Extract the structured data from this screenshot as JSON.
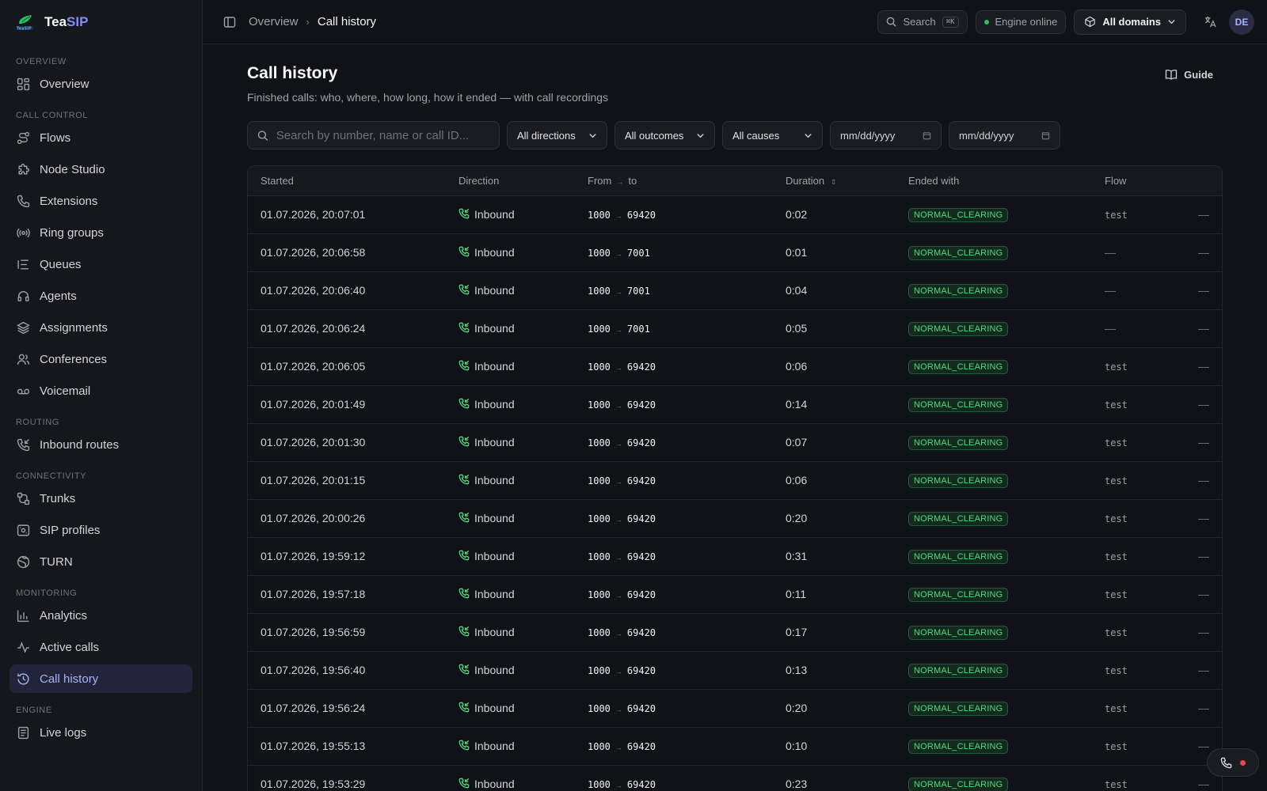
{
  "brand": {
    "name_a": "Tea",
    "name_b": "SIP"
  },
  "sidebar": {
    "sections": [
      {
        "heading": "OVERVIEW",
        "items": [
          {
            "label": "Overview",
            "icon": "grid-icon"
          }
        ]
      },
      {
        "heading": "CALL CONTROL",
        "items": [
          {
            "label": "Flows",
            "icon": "flows-icon"
          },
          {
            "label": "Node Studio",
            "icon": "puzzle-icon"
          },
          {
            "label": "Extensions",
            "icon": "phone-icon"
          },
          {
            "label": "Ring groups",
            "icon": "radio-icon"
          },
          {
            "label": "Queues",
            "icon": "list-icon"
          },
          {
            "label": "Agents",
            "icon": "headset-icon"
          },
          {
            "label": "Assignments",
            "icon": "layers-icon"
          },
          {
            "label": "Conferences",
            "icon": "users-icon"
          },
          {
            "label": "Voicemail",
            "icon": "voicemail-icon"
          }
        ]
      },
      {
        "heading": "ROUTING",
        "items": [
          {
            "label": "Inbound routes",
            "icon": "phone-incoming-icon"
          }
        ]
      },
      {
        "heading": "CONNECTIVITY",
        "items": [
          {
            "label": "Trunks",
            "icon": "trunk-icon"
          },
          {
            "label": "SIP profiles",
            "icon": "sip-icon"
          },
          {
            "label": "TURN",
            "icon": "globe-icon"
          }
        ]
      },
      {
        "heading": "MONITORING",
        "items": [
          {
            "label": "Analytics",
            "icon": "bar-chart-icon"
          },
          {
            "label": "Active calls",
            "icon": "activity-icon"
          },
          {
            "label": "Call history",
            "icon": "history-icon",
            "active": true
          }
        ]
      },
      {
        "heading": "ENGINE",
        "items": [
          {
            "label": "Live logs",
            "icon": "logs-icon"
          }
        ]
      }
    ]
  },
  "topbar": {
    "breadcrumb": [
      "Overview",
      "Call history"
    ],
    "search_label": "Search",
    "search_kbd": "⌘K",
    "engine_status": "Engine online",
    "domains_label": "All domains",
    "avatar": "DE"
  },
  "page": {
    "title": "Call history",
    "subtitle": "Finished calls: who, where, how long, how it ended — with call recordings",
    "guide_label": "Guide"
  },
  "filters": {
    "search_placeholder": "Search by number, name or call ID...",
    "directions": "All directions",
    "outcomes": "All outcomes",
    "causes": "All causes",
    "date_from": "mm/dd/yyyy",
    "date_to": "mm/dd/yyyy"
  },
  "table": {
    "headers": [
      "Started",
      "Direction",
      "From",
      "to",
      "Duration",
      "Ended with",
      "Flow"
    ],
    "rows": [
      {
        "started": "01.07.2026, 20:07:01",
        "direction": "Inbound",
        "from": "1000",
        "to": "69420",
        "duration": "0:02",
        "ended": "NORMAL_CLEARING",
        "flow": "test",
        "rec": "—"
      },
      {
        "started": "01.07.2026, 20:06:58",
        "direction": "Inbound",
        "from": "1000",
        "to": "7001",
        "duration": "0:01",
        "ended": "NORMAL_CLEARING",
        "flow": "—",
        "rec": "—"
      },
      {
        "started": "01.07.2026, 20:06:40",
        "direction": "Inbound",
        "from": "1000",
        "to": "7001",
        "duration": "0:04",
        "ended": "NORMAL_CLEARING",
        "flow": "—",
        "rec": "—"
      },
      {
        "started": "01.07.2026, 20:06:24",
        "direction": "Inbound",
        "from": "1000",
        "to": "7001",
        "duration": "0:05",
        "ended": "NORMAL_CLEARING",
        "flow": "—",
        "rec": "—"
      },
      {
        "started": "01.07.2026, 20:06:05",
        "direction": "Inbound",
        "from": "1000",
        "to": "69420",
        "duration": "0:06",
        "ended": "NORMAL_CLEARING",
        "flow": "test",
        "rec": "—"
      },
      {
        "started": "01.07.2026, 20:01:49",
        "direction": "Inbound",
        "from": "1000",
        "to": "69420",
        "duration": "0:14",
        "ended": "NORMAL_CLEARING",
        "flow": "test",
        "rec": "—"
      },
      {
        "started": "01.07.2026, 20:01:30",
        "direction": "Inbound",
        "from": "1000",
        "to": "69420",
        "duration": "0:07",
        "ended": "NORMAL_CLEARING",
        "flow": "test",
        "rec": "—"
      },
      {
        "started": "01.07.2026, 20:01:15",
        "direction": "Inbound",
        "from": "1000",
        "to": "69420",
        "duration": "0:06",
        "ended": "NORMAL_CLEARING",
        "flow": "test",
        "rec": "—"
      },
      {
        "started": "01.07.2026, 20:00:26",
        "direction": "Inbound",
        "from": "1000",
        "to": "69420",
        "duration": "0:20",
        "ended": "NORMAL_CLEARING",
        "flow": "test",
        "rec": "—"
      },
      {
        "started": "01.07.2026, 19:59:12",
        "direction": "Inbound",
        "from": "1000",
        "to": "69420",
        "duration": "0:31",
        "ended": "NORMAL_CLEARING",
        "flow": "test",
        "rec": "—"
      },
      {
        "started": "01.07.2026, 19:57:18",
        "direction": "Inbound",
        "from": "1000",
        "to": "69420",
        "duration": "0:11",
        "ended": "NORMAL_CLEARING",
        "flow": "test",
        "rec": "—"
      },
      {
        "started": "01.07.2026, 19:56:59",
        "direction": "Inbound",
        "from": "1000",
        "to": "69420",
        "duration": "0:17",
        "ended": "NORMAL_CLEARING",
        "flow": "test",
        "rec": "—"
      },
      {
        "started": "01.07.2026, 19:56:40",
        "direction": "Inbound",
        "from": "1000",
        "to": "69420",
        "duration": "0:13",
        "ended": "NORMAL_CLEARING",
        "flow": "test",
        "rec": "—"
      },
      {
        "started": "01.07.2026, 19:56:24",
        "direction": "Inbound",
        "from": "1000",
        "to": "69420",
        "duration": "0:20",
        "ended": "NORMAL_CLEARING",
        "flow": "test",
        "rec": "—"
      },
      {
        "started": "01.07.2026, 19:55:13",
        "direction": "Inbound",
        "from": "1000",
        "to": "69420",
        "duration": "0:10",
        "ended": "NORMAL_CLEARING",
        "flow": "test",
        "rec": "—"
      },
      {
        "started": "01.07.2026, 19:53:29",
        "direction": "Inbound",
        "from": "1000",
        "to": "69420",
        "duration": "0:23",
        "ended": "NORMAL_CLEARING",
        "flow": "test",
        "rec": "—"
      }
    ]
  },
  "colors": {
    "accent": "#818cf8",
    "success": "#4ade80",
    "danger": "#ef4444",
    "background": "#111217"
  }
}
